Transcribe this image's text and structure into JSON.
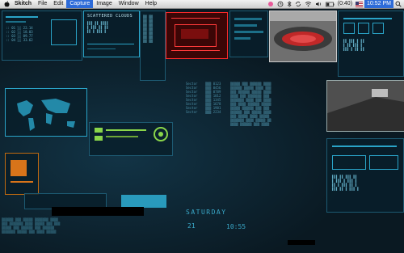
{
  "menubar": {
    "app_name": "Skitch",
    "items": [
      "File",
      "Edit",
      "Capture",
      "Image",
      "Window",
      "Help"
    ],
    "active_item": "Capture",
    "battery": "(0:40)",
    "clock": "10:52 PM"
  },
  "desktop": {
    "scattered_clouds_label": "SCATTERED CLOUDS",
    "day": "SATURDAY",
    "date": "21",
    "time": "10:55"
  },
  "colors": {
    "menu_active": "#2d6bd8",
    "hud_cyan": "#2aa4c8",
    "hud_red": "#ff2a2a",
    "desktop_bg": "#0a1922"
  }
}
